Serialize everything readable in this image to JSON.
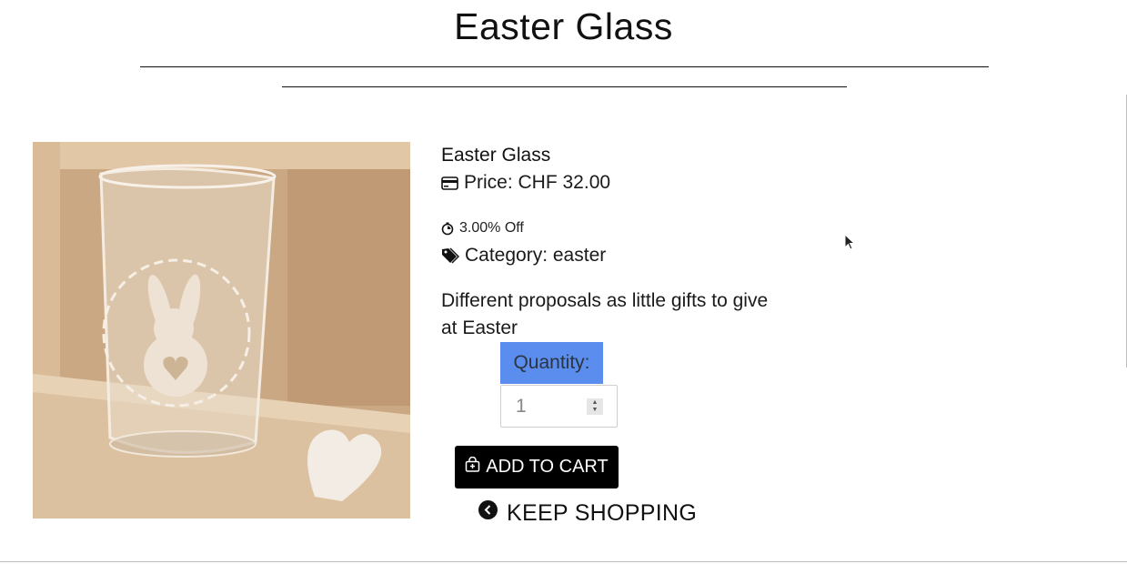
{
  "page": {
    "title": "Easter Glass"
  },
  "product": {
    "name": "Easter Glass",
    "price": "Price: CHF 32.00",
    "discount": "3.00% Off",
    "category": "Category: easter",
    "description": "Different proposals as little gifts to give at Easter",
    "image_alt": "Engraved drinking glass with a bunny and heart wreath"
  },
  "quantity": {
    "label": "Quantity:",
    "value": "1"
  },
  "actions": {
    "add_to_cart": "ADD TO CART",
    "keep_shopping": "KEEP SHOPPING"
  },
  "icons": {
    "price": "credit-card-icon",
    "discount": "stopwatch-icon",
    "category": "tags-icon",
    "add_to_cart": "shopping-bag-plus-icon",
    "keep_shopping": "chevron-left-circle-icon"
  },
  "colors": {
    "quantity_label_bg": "#5b8def",
    "button_bg": "#000000"
  }
}
